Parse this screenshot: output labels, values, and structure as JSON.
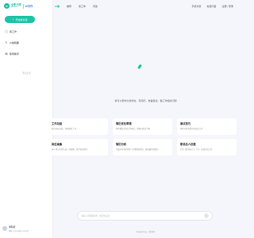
{
  "brand": {
    "logo_glyph": "e",
    "name_cn": "全职文库",
    "name_en": "qzwenku",
    "ai_label": "AI写作",
    "accent": "#1ec2a5"
  },
  "sidebar": {
    "new_chat": "开启新对话",
    "items": [
      {
        "label": "我工作",
        "icon": "message-icon"
      },
      {
        "label": "AI编辑器",
        "icon": "edit-icon"
      },
      {
        "label": "职场助手",
        "icon": "briefcase-icon"
      }
    ],
    "history_empty": "暂无记录",
    "user": {
      "name": "求职者",
      "meta": "消耗 107/100积, 10/100次"
    }
  },
  "topnav": {
    "items": [
      "AI搜",
      "推荐",
      "简工作",
      "问答"
    ],
    "right": [
      "手机浏览",
      "免费问答",
      "注册 | 登录"
    ]
  },
  "main": {
    "hint": "我可以帮你分析岗位、写简历、准备面试、做工作相关问题",
    "cards": [
      {
        "title": "工作总结",
        "desc": "职位内容总结，提炼精彩工作"
      },
      {
        "title": "简历优化帮我",
        "desc": "帮你量身定制工作报告，增强对面试了解"
      },
      {
        "title": "面试技巧",
        "desc": "帮你分析常见岗位面试工作"
      },
      {
        "title": "岗位画像",
        "desc": "输入岗位名称生成一份画像，提升面试能力"
      },
      {
        "title": "简历分析",
        "desc": "全面分析你的简历【AI精准推荐】，获取最匹配职位"
      },
      {
        "title": "职场达人技能",
        "desc": "分享【职场达人】工作，高效完成工作"
      }
    ],
    "input_placeholder": "请输入问题或需求，按回车发送",
    "send_icon": "send-icon",
    "footer": "内容由AI生成，仅供参考"
  }
}
